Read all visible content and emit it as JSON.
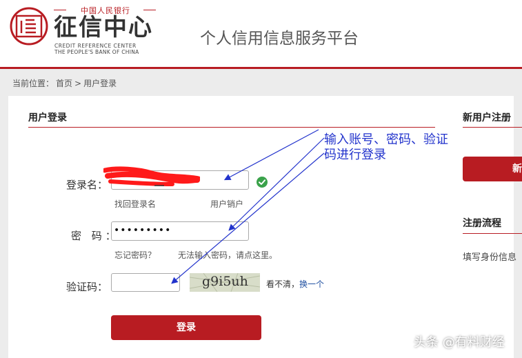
{
  "header": {
    "logo_top": "中国人民银行",
    "logo_cn": "征信中心",
    "logo_en_line1": "CREDIT REFERENCE CENTER",
    "logo_en_line2": "THE PEOPLE'S BANK OF CHINA",
    "platform_title": "个人信用信息服务平台"
  },
  "breadcrumb": {
    "prefix": "当前位置：",
    "home": "首页",
    "separator": ">",
    "current": "用户登录"
  },
  "login": {
    "title": "用户登录",
    "username_label": "登录名：",
    "password_label": "密 码：",
    "password_value": "•••••••••",
    "captcha_label": "验证码：",
    "find_username": "找回登录名",
    "cancel_account": "用户销户",
    "forgot_password": "忘记密码？",
    "cannot_input_password": "无法输入密码，请点这里。",
    "captcha_text": "g9i5uh",
    "captcha_refresh_prefix": "看不清，",
    "captcha_refresh_link": "换一个",
    "submit_label": "登录"
  },
  "sidebar": {
    "register_title": "新用户注册",
    "register_button": "新",
    "flow_title": "注册流程",
    "flow_step_1": "填写身份信息"
  },
  "annotation": "输入账号、密码、验证码进行登录",
  "watermark": "头条 @有料财经",
  "colors": {
    "brand_red": "#b81c22",
    "annotation_blue": "#2233cc",
    "success_green": "#3aa24a"
  }
}
